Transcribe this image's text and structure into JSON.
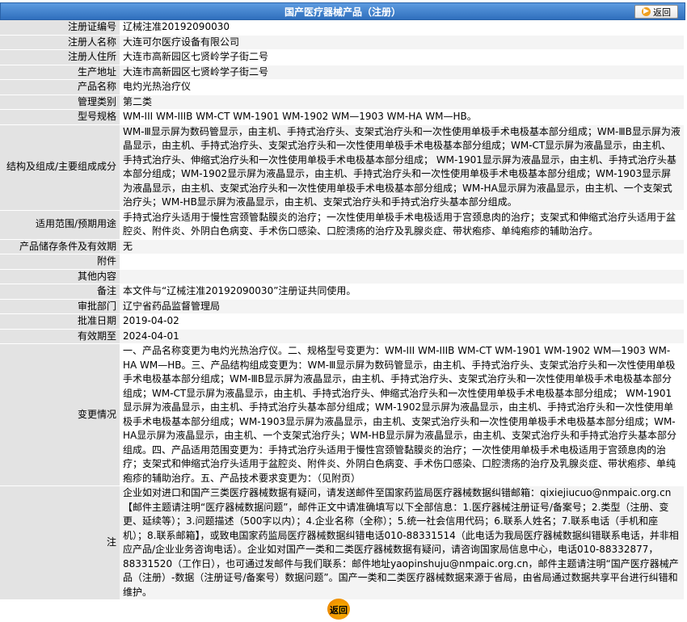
{
  "header": {
    "title": "国产医疗器械产品（注册）",
    "back_label": "返回"
  },
  "rows": [
    {
      "label": "注册证编号",
      "value": "辽械注准20192090030"
    },
    {
      "label": "注册人名称",
      "value": "大连可尔医疗设备有限公司"
    },
    {
      "label": "注册人住所",
      "value": "大连市高新园区七贤岭学子街二号"
    },
    {
      "label": "生产地址",
      "value": "大连市高新园区七贤岭学子街二号"
    },
    {
      "label": "产品名称",
      "value": "电灼光热治疗仪"
    },
    {
      "label": "管理类别",
      "value": "第二类"
    },
    {
      "label": "型号规格",
      "value": "WM-III WM-IIIB WM-CT WM-1901 WM-1902 WM—1903 WM-HA WM—HB。"
    },
    {
      "label": "结构及组成/主要组成成分",
      "value": "WM-Ⅲ显示屏为数码管显示，由主机、手持式治疗头、支架式治疗头和一次性使用单极手术电极基本部分组成；WM-ⅢB显示屏为液晶显示，由主机、手持式治疗头、支架式治疗头和一次性使用单极手术电极基本部分组成；WM-CT显示屏为液晶显示，由主机、手持式治疗头、伸缩式治疗头和一次性使用单极手术电极基本部分组成； WM-1901显示屏为液晶显示，由主机、手持式治疗头基本部分组成；WM-1902显示屏为液晶显示，由主机、手持式治疗头和一次性使用单极手术电极基本部分组成；WM-1903显示屏为液晶显示，由主机、支架式治疗头和一次性使用单极手术电极基本部分组成；WM-HA显示屏为液晶显示，由主机、一个支架式治疗头；WM-HB显示屏为液晶显示，由主机、支架式治疗头和手持式治疗头基本部分组成。"
    },
    {
      "label": "适用范围/预期用途",
      "value": "手持式治疗头适用于慢性宫颈管黏膜炎的治疗；一次性使用单极手术电极适用于宫颈息肉的治疗；支架式和伸缩式治疗头适用于盆腔炎、附件炎、外阴白色病变、手术伤口感染、口腔溃疡的治疗及乳腺炎症、带状疱疹、单纯疱疹的辅助治疗。"
    },
    {
      "label": "产品储存条件及有效期",
      "value": "无"
    },
    {
      "label": "附件",
      "value": ""
    },
    {
      "label": "其他内容",
      "value": ""
    },
    {
      "label": "备注",
      "value": "本文件与“辽械注准20192090030”注册证共同使用。"
    },
    {
      "label": "审批部门",
      "value": "辽宁省药品监督管理局"
    },
    {
      "label": "批准日期",
      "value": "2019-04-02"
    },
    {
      "label": "有效期至",
      "value": "2024-04-01"
    },
    {
      "label": "变更情况",
      "value": "一、产品名称变更为电灼光热治疗仪。二、规格型号变更为：WM-III WM-IIIB WM-CT WM-1901 WM-1902 WM—1903 WM-HA WM—HB。三、产品结构组成变更为：WM-Ⅲ显示屏为数码管显示，由主机、手持式治疗头、支架式治疗头和一次性使用单极手术电极基本部分组成；WM-ⅢB显示屏为液晶显示，由主机、手持式治疗头、支架式治疗头和一次性使用单极手术电极基本部分组成；WM-CT显示屏为液晶显示，由主机、手持式治疗头、伸缩式治疗头和一次性使用单极手术电极基本部分组成； WM-1901显示屏为液晶显示，由主机、手持式治疗头基本部分组成；WM-1902显示屏为液晶显示，由主机、手持式治疗头和一次性使用单极手术电极基本部分组成；WM-1903显示屏为液晶显示，由主机、支架式治疗头和一次性使用单极手术电极基本部分组成；WM-HA显示屏为液晶显示，由主机、一个支架式治疗头；WM-HB显示屏为液晶显示，由主机、支架式治疗头和手持式治疗头基本部分组成。四、产品适用范围变更为：手持式治疗头适用于慢性宫颈管黏膜炎的治疗；一次性使用单极手术电极适用于宫颈息肉的治疗；支架式和伸缩式治疗头适用于盆腔炎、附件炎、外阴白色病变、手术伤口感染、口腔溃疡的治疗及乳腺炎症、带状疱疹、单纯疱疹的辅助治疗。五、产品技术要求变更为：（见附页）"
    },
    {
      "label": "注",
      "value": "企业如对进口和国产三类医疗器械数据有疑问，请发送邮件至国家药监局医疗器械数据纠错邮箱：qixiejiucuo@nmpaic.org.cn【邮件主题请注明“医疗器械数据问题”，邮件正文中请准确填写以下全部信息：1.医疗器械注册证号/备案号；2.类型（注册、变更、延续等）；3.问题描述（500字以内）；4.企业名称（全称）；5.统一社会信用代码；6.联系人姓名；7.联系电话（手机和座机）；8.联系邮箱】，或致电国家药监局医疗器械数据纠错电话010-88331514（此电话为我局医疗器械数据纠错联系电话，并非相应产品/企业业务咨询电话）。企业如对国产一类和二类医疗器械数据有疑问，请咨询国家局信息中心，电话010-88332877，88331520（工作日），也可通过发邮件与我们联系：邮件地址yaopinshuju@nmpaic.org.cn，邮件主题请注明“国产医疗器械产品（注册）-数据（注册证号/备案号）数据问题”。国产一类和二类医疗器械数据来源于省局，由省局通过数据共享平台进行纠错和维护。"
    }
  ],
  "footer": {
    "back_label": "返回"
  },
  "colors": {
    "header": "#3a7bc8",
    "label_bg": "#e3e3e3",
    "accent": "#f29400"
  }
}
